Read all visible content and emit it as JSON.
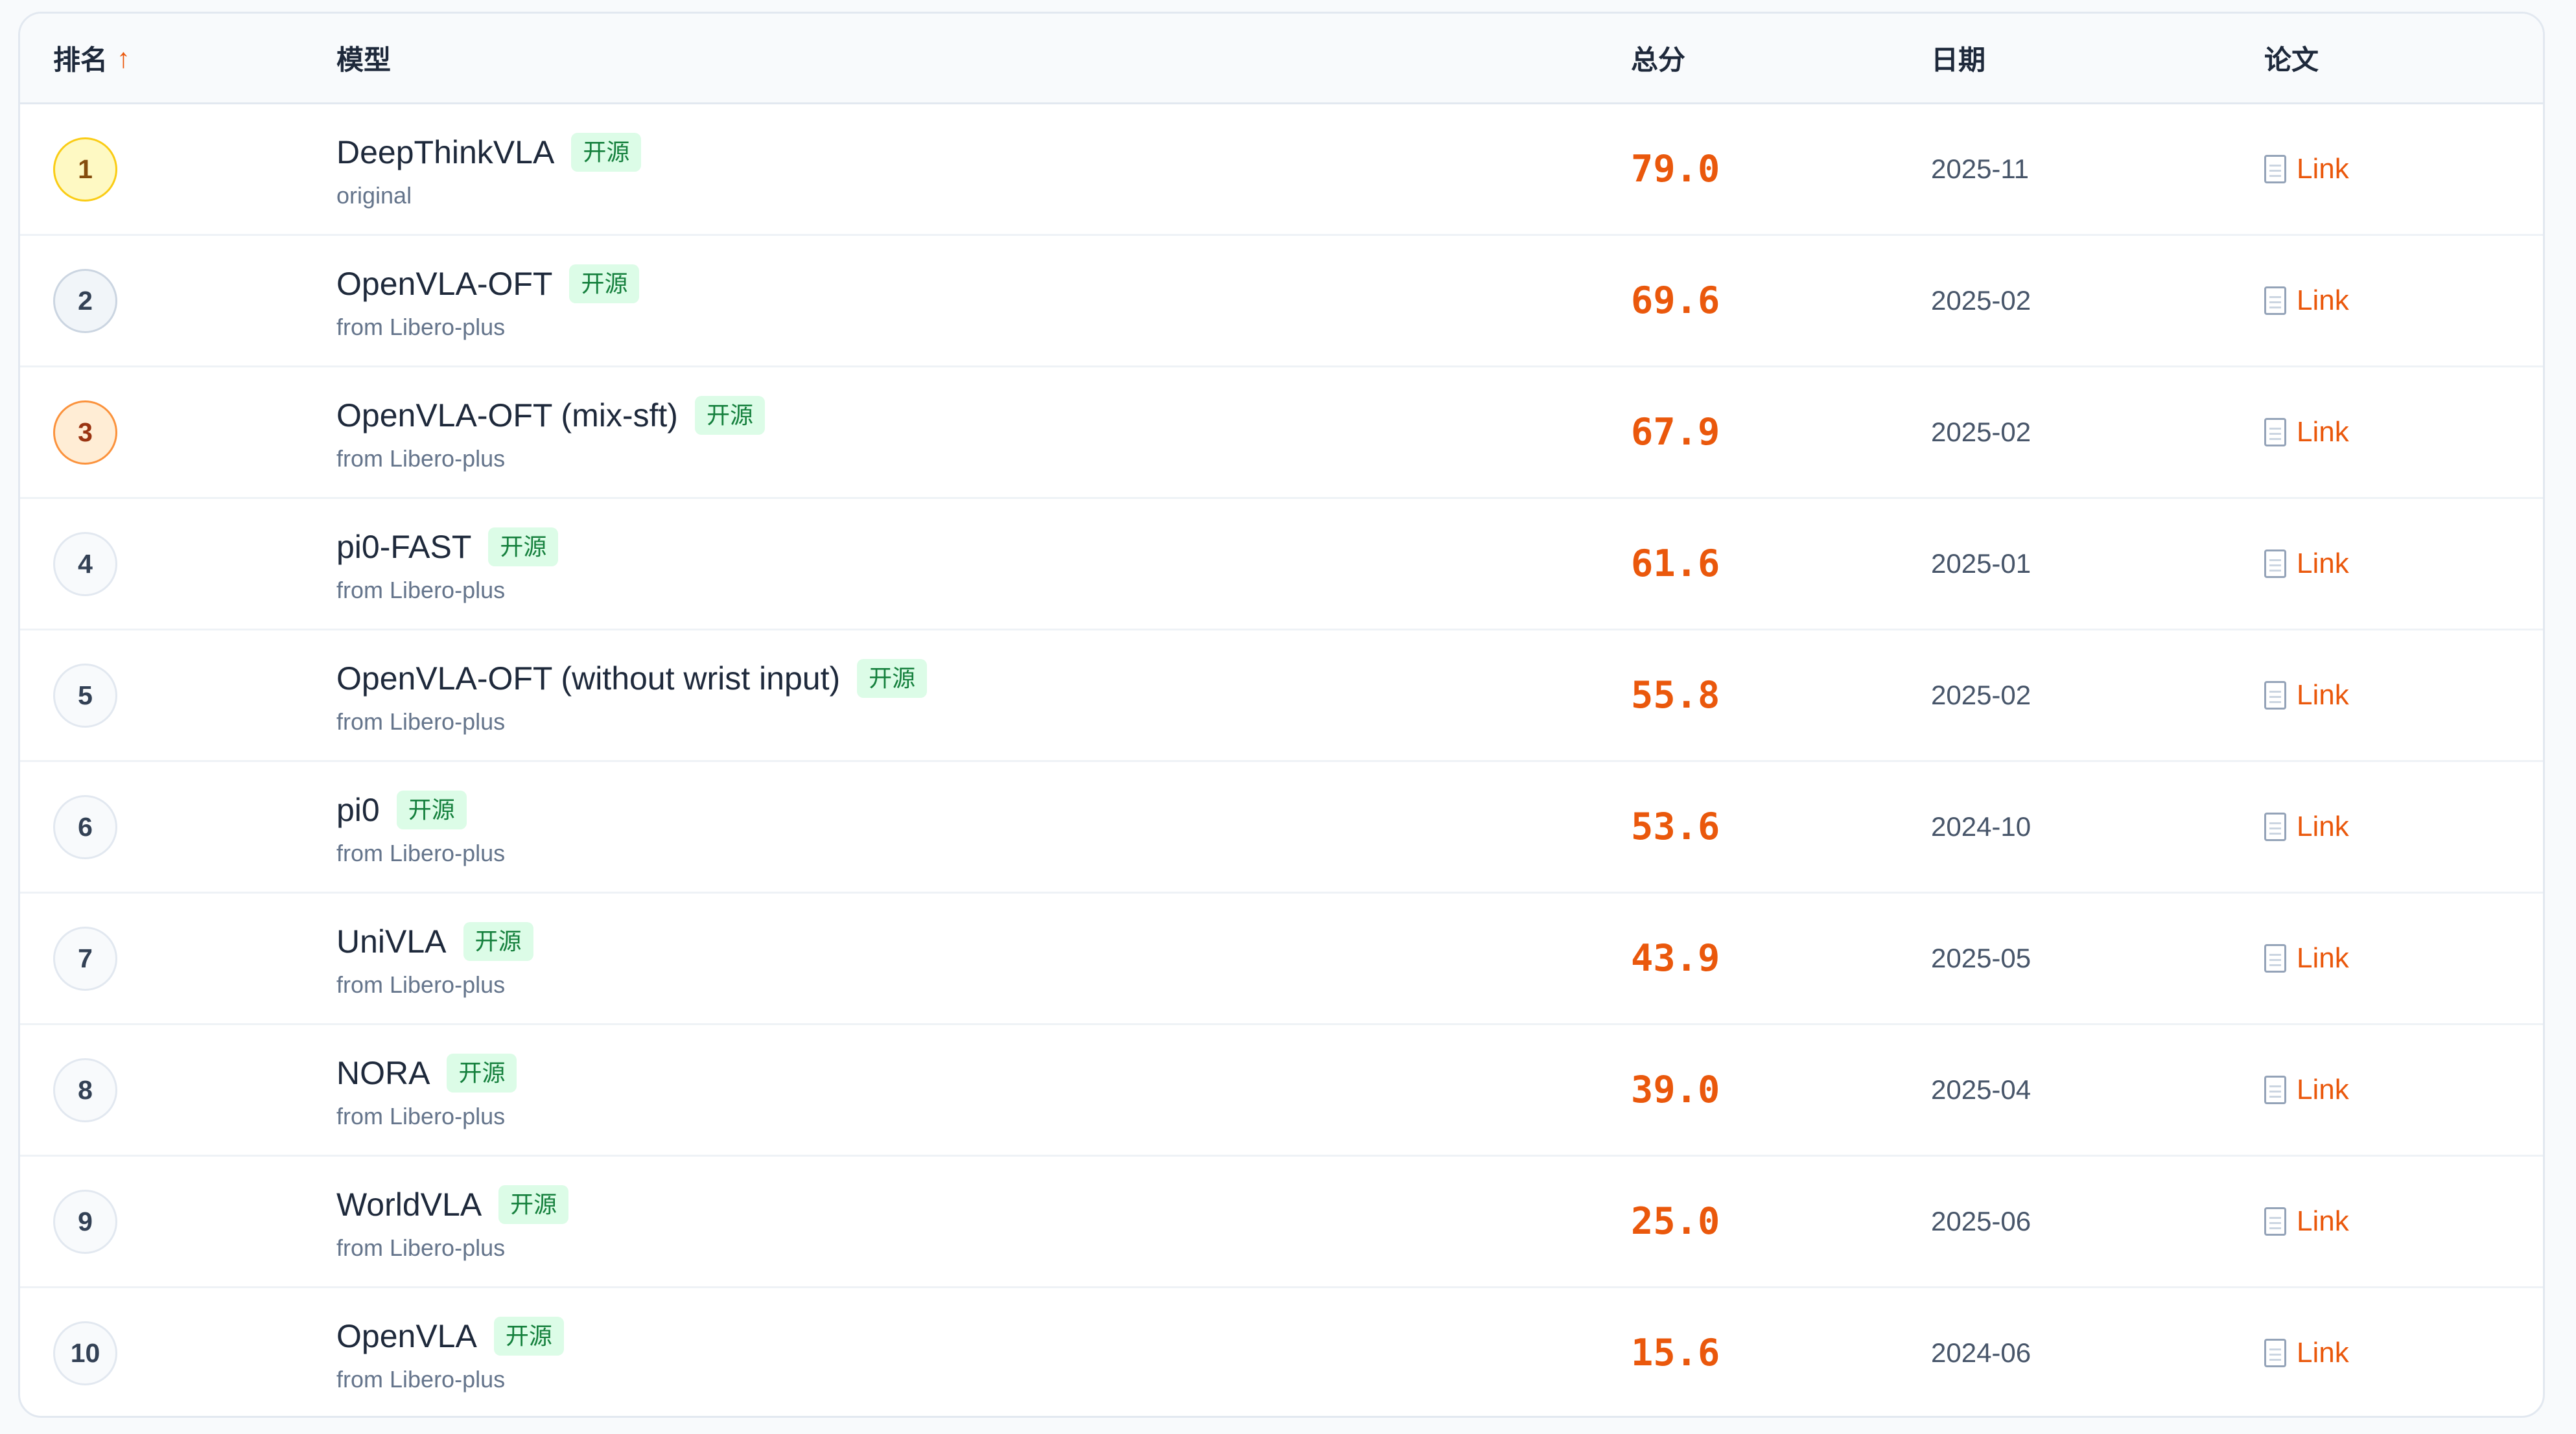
{
  "header": {
    "rank": "排名",
    "sort_indicator": "↑",
    "model": "模型",
    "score": "总分",
    "date": "日期",
    "paper": "论文"
  },
  "colors": {
    "accent": "#ea580c",
    "badge_bg": "#dcfce7",
    "badge_text": "#15803d",
    "gold": "#facc15",
    "bronze": "#fb923c"
  },
  "rows": [
    {
      "rank": "1",
      "name": "DeepThinkVLA",
      "badge": "开源",
      "source": "original",
      "score": "79.0",
      "date": "2025-11",
      "paper": "Link",
      "icon": "document-icon"
    },
    {
      "rank": "2",
      "name": "OpenVLA-OFT",
      "badge": "开源",
      "source": "from Libero-plus",
      "score": "69.6",
      "date": "2025-02",
      "paper": "Link",
      "icon": "document-icon"
    },
    {
      "rank": "3",
      "name": "OpenVLA-OFT (mix-sft)",
      "badge": "开源",
      "source": "from Libero-plus",
      "score": "67.9",
      "date": "2025-02",
      "paper": "Link",
      "icon": "document-icon"
    },
    {
      "rank": "4",
      "name": "pi0-FAST",
      "badge": "开源",
      "source": "from Libero-plus",
      "score": "61.6",
      "date": "2025-01",
      "paper": "Link",
      "icon": "document-icon"
    },
    {
      "rank": "5",
      "name": "OpenVLA-OFT (without wrist input)",
      "badge": "开源",
      "source": "from Libero-plus",
      "score": "55.8",
      "date": "2025-02",
      "paper": "Link",
      "icon": "document-icon"
    },
    {
      "rank": "6",
      "name": "pi0",
      "badge": "开源",
      "source": "from Libero-plus",
      "score": "53.6",
      "date": "2024-10",
      "paper": "Link",
      "icon": "document-icon"
    },
    {
      "rank": "7",
      "name": "UniVLA",
      "badge": "开源",
      "source": "from Libero-plus",
      "score": "43.9",
      "date": "2025-05",
      "paper": "Link",
      "icon": "document-icon"
    },
    {
      "rank": "8",
      "name": "NORA",
      "badge": "开源",
      "source": "from Libero-plus",
      "score": "39.0",
      "date": "2025-04",
      "paper": "Link",
      "icon": "document-icon"
    },
    {
      "rank": "9",
      "name": "WorldVLA",
      "badge": "开源",
      "source": "from Libero-plus",
      "score": "25.0",
      "date": "2025-06",
      "paper": "Link",
      "icon": "document-icon"
    },
    {
      "rank": "10",
      "name": "OpenVLA",
      "badge": "开源",
      "source": "from Libero-plus",
      "score": "15.6",
      "date": "2024-06",
      "paper": "Link",
      "icon": "document-icon"
    }
  ]
}
